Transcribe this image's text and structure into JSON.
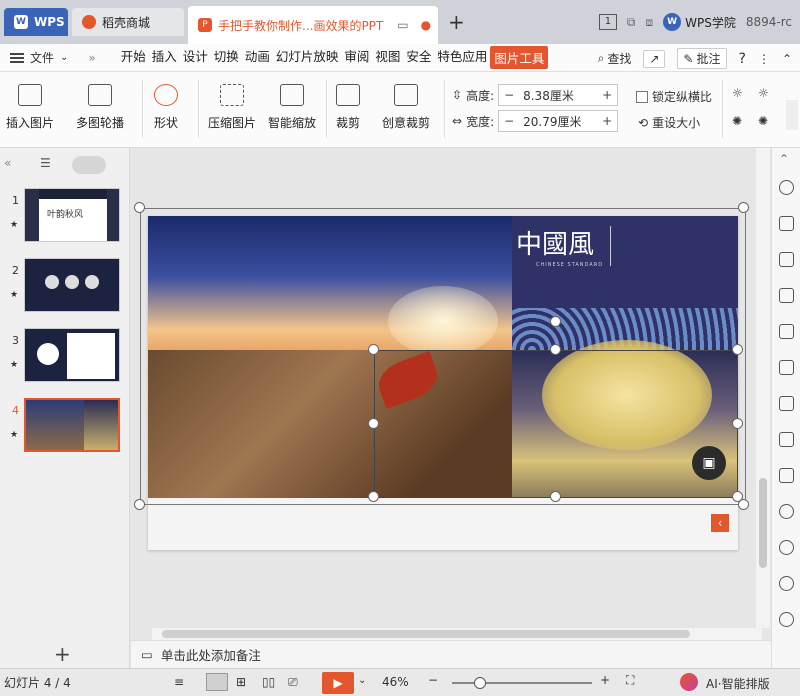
{
  "tabs": {
    "wps": "WPS",
    "store": "稻壳商城",
    "doc": "手把手教你制作...画效果的PPT",
    "page_count": "1",
    "academy": "WPS学院",
    "user": "8894-rc"
  },
  "menu": {
    "file": "文件",
    "items": [
      "开始",
      "插入",
      "设计",
      "切换",
      "动画",
      "幻灯片放映",
      "审阅",
      "视图",
      "安全",
      "特色应用",
      "图片工具"
    ],
    "search": "查找",
    "comment": "批注",
    "help": "?"
  },
  "ribbon": {
    "insert_picture": "插入图片",
    "multi_carousel": "多图轮播",
    "shape": "形状",
    "compress": "压缩图片",
    "smart_scale": "智能缩放",
    "crop": "裁剪",
    "creative_crop": "创意裁剪",
    "height_label": "高度:",
    "height_value": "8.38厘米",
    "width_label": "宽度:",
    "width_value": "20.79厘米",
    "lock_ratio": "锁定纵横比",
    "reset_size": "重设大小"
  },
  "slides": [
    {
      "num": "1",
      "title": "叶韵秋风"
    },
    {
      "num": "2"
    },
    {
      "num": "3"
    },
    {
      "num": "4"
    }
  ],
  "slide4": {
    "heading": "中國風",
    "subheading": "CHINESE STANDARD"
  },
  "notes": {
    "placeholder": "单击此处添加备注"
  },
  "status": {
    "slide_info": "幻灯片 4 / 4",
    "zoom": "46%",
    "ai": "AI·智能排版"
  },
  "colors": {
    "accent": "#e4572e",
    "wps_blue": "#3b63b8"
  }
}
